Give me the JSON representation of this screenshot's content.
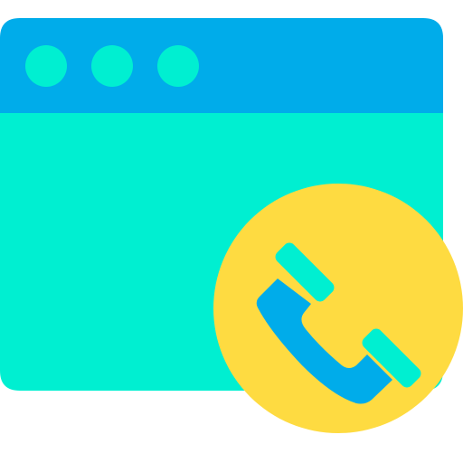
{
  "icon": {
    "name": "browser-window-phone-call-icon",
    "colors": {
      "window_body": "#00efd1",
      "title_bar": "#00acea",
      "window_dots": "#00efd1",
      "call_badge": "#fedb41",
      "handset_body": "#00acea",
      "handset_pads": "#00efd1"
    },
    "window_dot_count": 3
  }
}
